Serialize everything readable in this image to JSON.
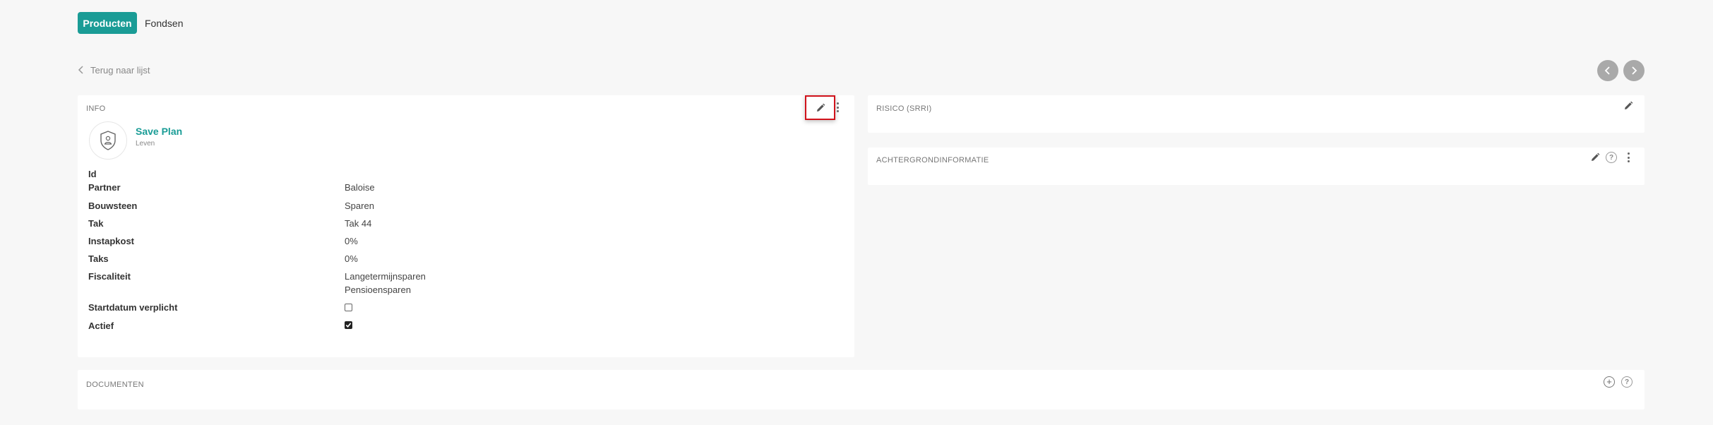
{
  "tabs": [
    {
      "label": "Producten",
      "active": true
    },
    {
      "label": "Fondsen",
      "active": false
    }
  ],
  "back_link": "Terug naar lijst",
  "info_card": {
    "title": "INFO",
    "product_name": "Save Plan",
    "product_category": "Leven",
    "rows": [
      {
        "label": "Id",
        "value": ""
      },
      {
        "label": "Partner",
        "value": "Baloise"
      },
      {
        "label": "Bouwsteen",
        "value": "Sparen"
      },
      {
        "label": "Tak",
        "value": "Tak 44"
      },
      {
        "label": "Instapkost",
        "value": "0%"
      },
      {
        "label": "Taks",
        "value": "0%"
      },
      {
        "label": "Fiscaliteit",
        "value_lines": [
          "Langetermijnsparen",
          "Pensioensparen"
        ]
      },
      {
        "label": "Startdatum verplicht",
        "checkbox": false
      },
      {
        "label": "Actief",
        "checkbox": true
      }
    ]
  },
  "risk_card": {
    "title": "RISICO (SRRI)"
  },
  "background_card": {
    "title": "ACHTERGRONDINFORMATIE",
    "help": "?"
  },
  "documents_card": {
    "title": "DOCUMENTEN",
    "help": "?",
    "add": "+"
  },
  "icons": [
    "chevron-left-icon",
    "chevron-right-icon",
    "pencil-icon",
    "more-vertical-icon",
    "help-icon",
    "add-circle-icon",
    "shield-user-icon",
    "checkmark-icon"
  ],
  "colors": {
    "accent": "#1a9c96",
    "highlight": "#d0121b",
    "background": "#f7f7f7",
    "nav_button": "#a9a9a9"
  }
}
